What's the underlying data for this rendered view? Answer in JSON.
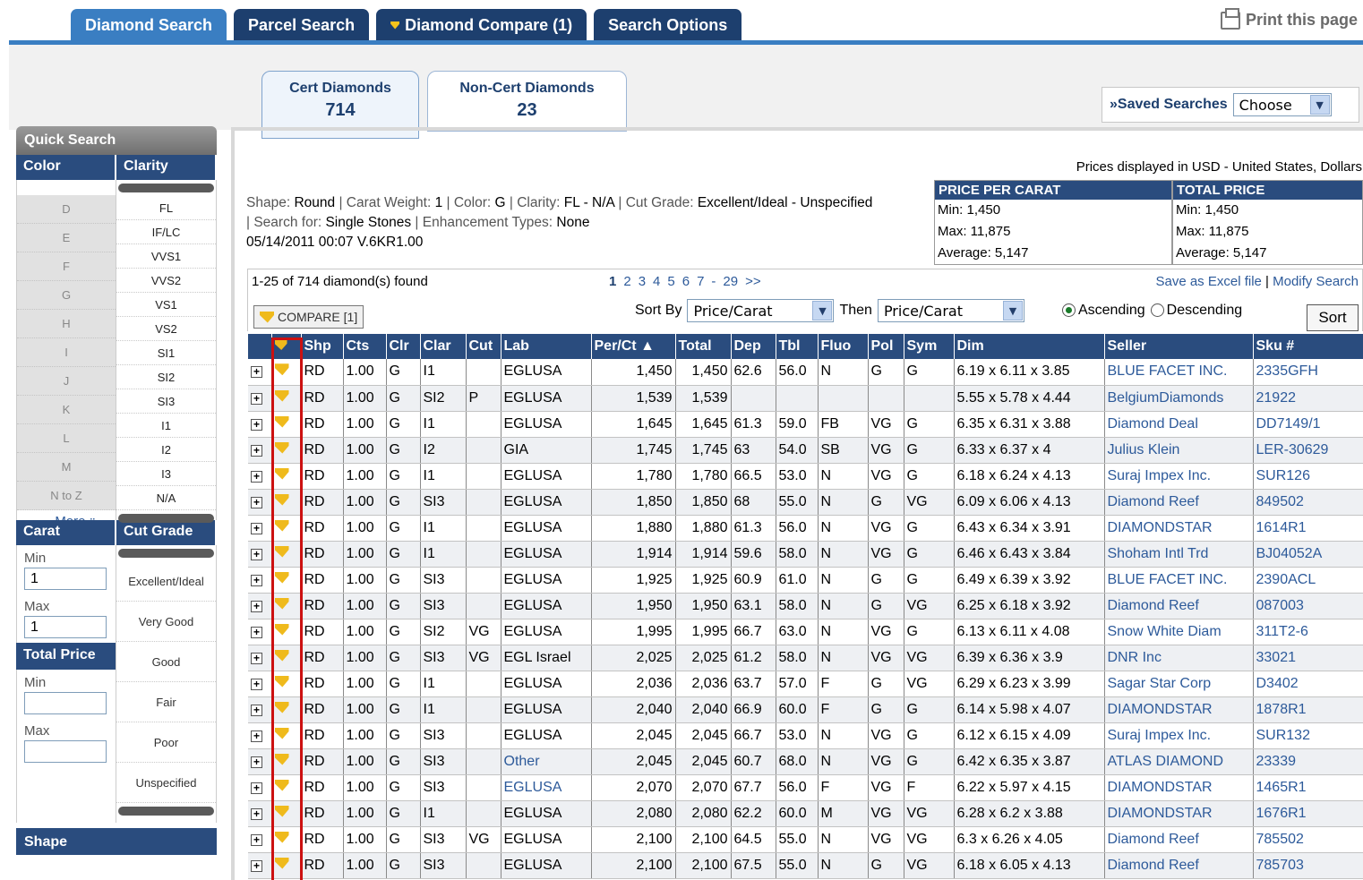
{
  "top_tabs": [
    "Diamond Search",
    "Parcel Search",
    "Diamond Compare (1)",
    "Search Options"
  ],
  "print_label": "Print this page",
  "cert_tabs": [
    {
      "label": "Cert Diamonds",
      "count": "714"
    },
    {
      "label": "Non-Cert Diamonds",
      "count": "23"
    }
  ],
  "saved": {
    "label": "»Saved Searches",
    "select_value": "Choose"
  },
  "sidebar": {
    "quick_search": "Quick Search",
    "color_head": "Color",
    "clarity_head": "Clarity",
    "colors": [
      "D",
      "E",
      "F",
      "G",
      "H",
      "I",
      "J",
      "K",
      "L",
      "M",
      "N to Z"
    ],
    "clarities": [
      "FL",
      "IF/LC",
      "VVS1",
      "VVS2",
      "VS1",
      "VS2",
      "SI1",
      "SI2",
      "SI3",
      "I1",
      "I2",
      "I3",
      "N/A"
    ],
    "more": "More",
    "carat_head": "Carat",
    "cut_head": "Cut Grade",
    "min_label": "Min",
    "max_label": "Max",
    "carat_min": "1",
    "carat_max": "1",
    "cut_grades": [
      "Excellent/Ideal",
      "Very Good",
      "Good",
      "Fair",
      "Poor",
      "Unspecified"
    ],
    "total_price_head": "Total Price",
    "shape_head": "Shape"
  },
  "criteria": {
    "shape_lbl": "Shape:",
    "shape": "Round",
    "carat_lbl": "Carat Weight:",
    "carat": "1",
    "color_lbl": "Color:",
    "color": "G",
    "clarity_lbl": "Clarity:",
    "clarity": "FL - N/A",
    "cut_lbl": "Cut Grade:",
    "cut": "Excellent/Ideal - Unspecified",
    "search_lbl": "Search for:",
    "search": "Single Stones",
    "enh_lbl": "Enhancement Types:",
    "enh": "None",
    "stamp": "05/14/2011 00:07 V.6KR1.00"
  },
  "prices_note": "Prices displayed in USD - United States, Dollars",
  "ppc": {
    "head": "PRICE PER CARAT",
    "min": "Min: 1,450",
    "max": "Max: 11,875",
    "avg": "Average: 5,147"
  },
  "tp": {
    "head": "TOTAL PRICE",
    "min": "Min: 1,450",
    "max": "Max: 11,875",
    "avg": "Average: 5,147"
  },
  "results": {
    "found": "1-25 of 714 diamond(s) found",
    "pages": [
      "1",
      "2",
      "3",
      "4",
      "5",
      "6",
      "7",
      "-",
      "29",
      ">>"
    ],
    "save_excel": "Save as Excel file",
    "sep": "|",
    "modify": "Modify Search",
    "compare_btn": "COMPARE [1]",
    "sort_by": "Sort By",
    "sort1": "Price/Carat",
    "then": "Then",
    "sort2": "Price/Carat",
    "ascending": "Ascending",
    "descending": "Descending",
    "sort_btn": "Sort"
  },
  "columns": [
    "Shp",
    "Cts",
    "Clr",
    "Clar",
    "Cut",
    "Lab",
    "Per/Ct ▲",
    "Total",
    "Dep",
    "Tbl",
    "Fluo",
    "Pol",
    "Sym",
    "Dim",
    "Seller",
    "Sku #"
  ],
  "rows": [
    [
      "RD",
      "1.00",
      "G",
      "I1",
      "",
      "EGLUSA",
      "1,450",
      "1,450",
      "62.6",
      "56.0",
      "N",
      "G",
      "G",
      "6.19 x 6.11 x 3.85",
      "BLUE FACET INC.",
      "2335GFH"
    ],
    [
      "RD",
      "1.00",
      "G",
      "SI2",
      "P",
      "EGLUSA",
      "1,539",
      "1,539",
      "",
      "",
      "",
      "",
      "",
      "5.55 x 5.78 x 4.44",
      "BelgiumDiamonds",
      "21922"
    ],
    [
      "RD",
      "1.00",
      "G",
      "I1",
      "",
      "EGLUSA",
      "1,645",
      "1,645",
      "61.3",
      "59.0",
      "FB",
      "VG",
      "G",
      "6.35 x 6.31 x 3.88",
      "Diamond Deal",
      "DD7149/1"
    ],
    [
      "RD",
      "1.00",
      "G",
      "I2",
      "",
      "GIA",
      "1,745",
      "1,745",
      "63",
      "54.0",
      "SB",
      "VG",
      "G",
      "6.33 x 6.37 x 4",
      "Julius Klein",
      "LER-30629"
    ],
    [
      "RD",
      "1.00",
      "G",
      "I1",
      "",
      "EGLUSA",
      "1,780",
      "1,780",
      "66.5",
      "53.0",
      "N",
      "VG",
      "G",
      "6.18 x 6.24 x 4.13",
      "Suraj Impex Inc.",
      "SUR126"
    ],
    [
      "RD",
      "1.00",
      "G",
      "SI3",
      "",
      "EGLUSA",
      "1,850",
      "1,850",
      "68",
      "55.0",
      "N",
      "G",
      "VG",
      "6.09 x 6.06 x 4.13",
      "Diamond Reef",
      "849502"
    ],
    [
      "RD",
      "1.00",
      "G",
      "I1",
      "",
      "EGLUSA",
      "1,880",
      "1,880",
      "61.3",
      "56.0",
      "N",
      "VG",
      "G",
      "6.43 x 6.34 x 3.91",
      "DIAMONDSTAR",
      "1614R1"
    ],
    [
      "RD",
      "1.00",
      "G",
      "I1",
      "",
      "EGLUSA",
      "1,914",
      "1,914",
      "59.6",
      "58.0",
      "N",
      "VG",
      "G",
      "6.46 x 6.43 x 3.84",
      "Shoham Intl Trd",
      "BJ04052A"
    ],
    [
      "RD",
      "1.00",
      "G",
      "SI3",
      "",
      "EGLUSA",
      "1,925",
      "1,925",
      "60.9",
      "61.0",
      "N",
      "G",
      "G",
      "6.49 x 6.39 x 3.92",
      "BLUE FACET INC.",
      "2390ACL"
    ],
    [
      "RD",
      "1.00",
      "G",
      "SI3",
      "",
      "EGLUSA",
      "1,950",
      "1,950",
      "63.1",
      "58.0",
      "N",
      "G",
      "VG",
      "6.25 x 6.18 x 3.92",
      "Diamond Reef",
      "087003"
    ],
    [
      "RD",
      "1.00",
      "G",
      "SI2",
      "VG",
      "EGLUSA",
      "1,995",
      "1,995",
      "66.7",
      "63.0",
      "N",
      "VG",
      "G",
      "6.13 x 6.11 x 4.08",
      "Snow White Diam",
      "311T2-6"
    ],
    [
      "RD",
      "1.00",
      "G",
      "SI3",
      "VG",
      "EGL Israel",
      "2,025",
      "2,025",
      "61.2",
      "58.0",
      "N",
      "VG",
      "VG",
      "6.39 x 6.36 x 3.9",
      "DNR Inc",
      "33021"
    ],
    [
      "RD",
      "1.00",
      "G",
      "I1",
      "",
      "EGLUSA",
      "2,036",
      "2,036",
      "63.7",
      "57.0",
      "F",
      "G",
      "VG",
      "6.29 x 6.23 x 3.99",
      "Sagar Star Corp",
      "D3402"
    ],
    [
      "RD",
      "1.00",
      "G",
      "I1",
      "",
      "EGLUSA",
      "2,040",
      "2,040",
      "66.9",
      "60.0",
      "F",
      "G",
      "G",
      "6.14 x 5.98 x 4.07",
      "DIAMONDSTAR",
      "1878R1"
    ],
    [
      "RD",
      "1.00",
      "G",
      "SI3",
      "",
      "EGLUSA",
      "2,045",
      "2,045",
      "66.7",
      "53.0",
      "N",
      "VG",
      "G",
      "6.12 x 6.15 x 4.09",
      "Suraj Impex Inc.",
      "SUR132"
    ],
    [
      "RD",
      "1.00",
      "G",
      "SI3",
      "",
      "Other",
      "2,045",
      "2,045",
      "60.7",
      "68.0",
      "N",
      "VG",
      "G",
      "6.42 x 6.35 x 3.87",
      "ATLAS DIAMOND",
      "23339"
    ],
    [
      "RD",
      "1.00",
      "G",
      "SI3",
      "",
      "EGLUSA",
      "2,070",
      "2,070",
      "67.7",
      "56.0",
      "F",
      "VG",
      "F",
      "6.22 x 5.97 x 4.15",
      "DIAMONDSTAR",
      "1465R1"
    ],
    [
      "RD",
      "1.00",
      "G",
      "I1",
      "",
      "EGLUSA",
      "2,080",
      "2,080",
      "62.2",
      "60.0",
      "M",
      "VG",
      "VG",
      "6.28 x 6.2 x 3.88",
      "DIAMONDSTAR",
      "1676R1"
    ],
    [
      "RD",
      "1.00",
      "G",
      "SI3",
      "VG",
      "EGLUSA",
      "2,100",
      "2,100",
      "64.5",
      "55.0",
      "N",
      "VG",
      "VG",
      "6.3 x 6.26 x 4.05",
      "Diamond Reef",
      "785502"
    ],
    [
      "RD",
      "1.00",
      "G",
      "SI3",
      "",
      "EGLUSA",
      "2,100",
      "2,100",
      "67.5",
      "55.0",
      "N",
      "G",
      "VG",
      "6.18 x 6.05 x 4.13",
      "Diamond Reef",
      "785703"
    ]
  ]
}
